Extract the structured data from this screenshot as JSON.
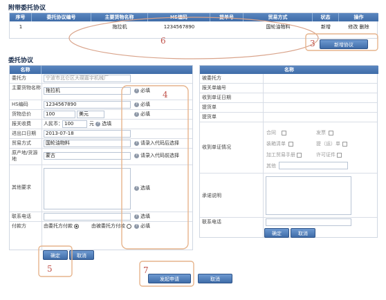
{
  "attached": {
    "title": "附带委托协议",
    "columns": [
      "序号",
      "委托协议编号",
      "主要货物名称",
      "HS编码",
      "提单号",
      "贸易方式",
      "状态",
      "操作"
    ],
    "row": {
      "index": "1",
      "agreement_no": "",
      "goods_name": "拖拉机",
      "hs_code": "1234567890",
      "bill_no": "",
      "trade_mode": "国轮油物料",
      "status": "新增",
      "edit": "修改",
      "delete": "删除"
    },
    "new_button": "新增协议"
  },
  "form": {
    "title": "委托协议",
    "left_header": "名称",
    "fields": {
      "client_label": "委托方",
      "client_value": "宁波市北仑区大碶嘉宇机械厂",
      "goods_label": "主要货物名称",
      "goods_value": "拖拉机",
      "hs_label": "HS编码",
      "hs_value": "1234567890",
      "price_label": "货物总价",
      "price_value": "100",
      "price_currency": "美元",
      "fee_label": "报关收费",
      "fee_currency": "人民币：",
      "fee_value": "100",
      "fee_unit": "元",
      "import_date_label": "进出口日期",
      "import_date_value": "2013-07-18",
      "trade_label": "贸易方式",
      "trade_value": "国轮油物料",
      "origin_label": "原产地/货源地",
      "origin_value": "蒙古",
      "other_label": "其他要求",
      "phone_label": "联系电话",
      "pay_label": "付款方",
      "pay_option1": "由委托方付款",
      "pay_option2": "由被委托方付款"
    },
    "notes": {
      "required": "必填",
      "optional": "选填",
      "code_required": "请录入代码后选择",
      "code_optional": "请录入代码前选择"
    },
    "confirm": "确定",
    "cancel": "取消"
  },
  "right": {
    "header": "名称",
    "rows": [
      "被委托方",
      "报关单编号",
      "收到单证日期",
      "提货单",
      "提货单"
    ],
    "docs_label": "收到单证情况",
    "checks": [
      "合同",
      "发票",
      "装箱清单",
      "提（运）单",
      "加工贸易手册",
      "许可证件",
      "其他"
    ],
    "remark_label": "承诺说明",
    "phone_label": "联系电话",
    "confirm": "确定",
    "cancel": "取消"
  },
  "bottom": {
    "submit": "发起申请",
    "cancel": "取消"
  },
  "annotations": [
    "6",
    "3",
    "4",
    "5",
    "7"
  ],
  "colors": {
    "header": "#4a78b4",
    "annotation": "#c0524a",
    "border": "#d8dde6"
  }
}
